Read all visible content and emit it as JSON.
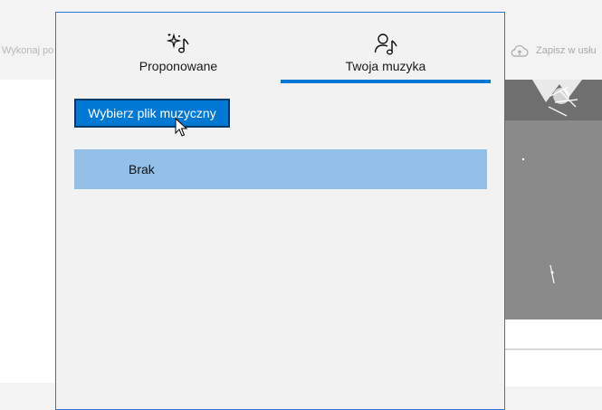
{
  "background_app": {
    "toolbar_left_text": "Wykonaj po",
    "save_label": "Zapisz w usłu",
    "save_icon": "cloud-upload-icon"
  },
  "flyout": {
    "tabs": [
      {
        "label": "Proponowane",
        "icon": "sparkle-music-note-icon",
        "selected": false
      },
      {
        "label": "Twoja muzyka",
        "icon": "person-music-note-icon",
        "selected": true
      }
    ],
    "choose_file_button": "Wybierz plik muzyczny",
    "music_items": [
      {
        "label": "Brak",
        "selected": true
      }
    ]
  },
  "colors": {
    "accent": "#0078d4",
    "selected_item": "#93c0e8",
    "flyout_border": "#2a78c9",
    "flyout_background": "#f2f2f2"
  }
}
